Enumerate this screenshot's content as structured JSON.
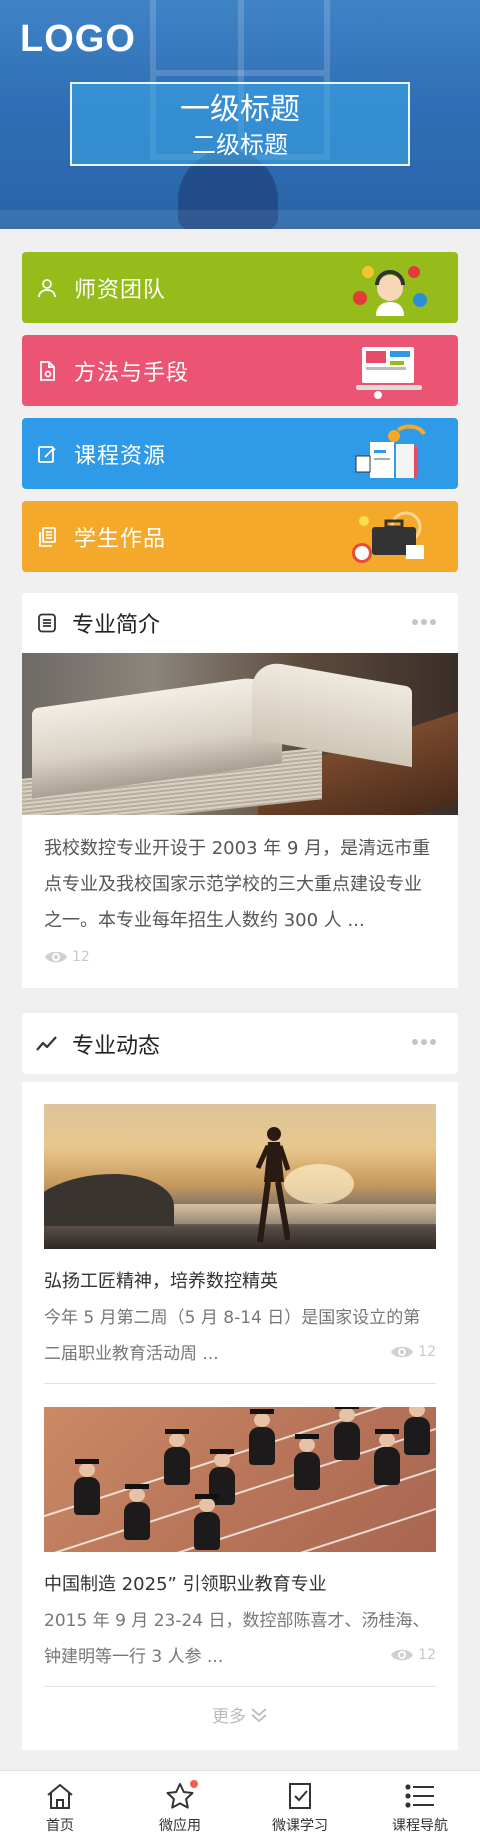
{
  "header": {
    "logo": "LOGO",
    "title_primary": "一级标题",
    "title_secondary": "二级标题"
  },
  "menu": [
    {
      "label": "师资团队",
      "icon": "user-icon",
      "color": "#95bc1a"
    },
    {
      "label": "方法与手段",
      "icon": "document-icon",
      "color": "#ec5474"
    },
    {
      "label": "课程资源",
      "icon": "edit-icon",
      "color": "#2e9ae8"
    },
    {
      "label": "学生作品",
      "icon": "files-icon",
      "color": "#f4a92a"
    }
  ],
  "intro": {
    "title": "专业简介",
    "icon": "book-icon",
    "text": "我校数控专业开设于 2003 年 9 月，是清远市重点专业及我校国家示范学校的三大重点建设专业之一。本专业每年招生人数约 300 人 ...",
    "views": "12"
  },
  "news": {
    "title": "专业动态",
    "icon": "trend-icon",
    "items": [
      {
        "title": "弘扬工匠精神，培养数控精英",
        "desc": "今年 5 月第二周（5 月 8-14 日）是国家设立的第二届职业教育活动周 ...",
        "views": "12"
      },
      {
        "title": "中国制造 2025” 引领职业教育专业",
        "desc": "2015 年 9 月 23-24 日，数控部陈喜才、汤桂海、钟建明等一行 3 人参 ...",
        "views": "12"
      }
    ],
    "more": "更多"
  },
  "tabbar": [
    {
      "label": "首页",
      "icon": "home-icon"
    },
    {
      "label": "微应用",
      "icon": "star-icon",
      "badge": true
    },
    {
      "label": "微课学习",
      "icon": "checklist-icon"
    },
    {
      "label": "课程导航",
      "icon": "list-icon"
    }
  ],
  "colors": {
    "accent_blue": "#2f6fb5",
    "badge_red": "#f0604a",
    "muted_text": "#777777"
  }
}
